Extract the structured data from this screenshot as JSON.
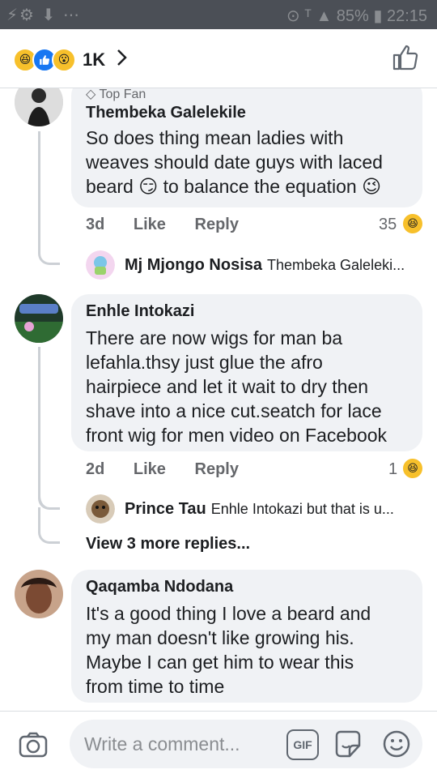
{
  "status_bar": {
    "left": "⚡⚙ ⬇ ⋯",
    "right": "⊙ ᵀ ▲ 85% ▮ 22:15"
  },
  "header": {
    "reaction_count": "1K"
  },
  "comments": [
    {
      "badge": "Top Fan",
      "author": "Thembeka Galelekile",
      "lines": [
        "So does thing mean ladies with",
        "weaves should date guys with laced",
        "beard 😏 to balance the equation 😉"
      ],
      "time": "3d",
      "like": "Like",
      "reply": "Reply",
      "reactions": "35",
      "reply_preview": {
        "author": "Mj Mjongo Nosisa",
        "text": "Thembeka Galeleki..."
      }
    },
    {
      "author": "Enhle Intokazi",
      "lines": [
        "There are now wigs for man ba",
        "lefahla.thsy just glue the afro",
        "hairpiece and let it wait to dry then",
        "shave into a nice cut.seatch for lace",
        "front wig for men video on Facebook"
      ],
      "time": "2d",
      "like": "Like",
      "reply": "Reply",
      "reactions": "1",
      "reply_preview": {
        "author": "Prince Tau",
        "text": "Enhle Intokazi but that is u..."
      },
      "more_replies": "View 3 more replies..."
    },
    {
      "author": "Qaqamba Ndodana",
      "lines": [
        "It's a good thing I love a beard and",
        "my man doesn't like growing his.",
        "Maybe I can get him to wear this",
        "from time to time"
      ]
    }
  ],
  "composer": {
    "placeholder": "Write a comment...",
    "gif_label": "GIF"
  },
  "colors": {
    "bubble": "#f0f2f5",
    "haha": "#f7c02b",
    "like_blue": "#1877f2"
  }
}
